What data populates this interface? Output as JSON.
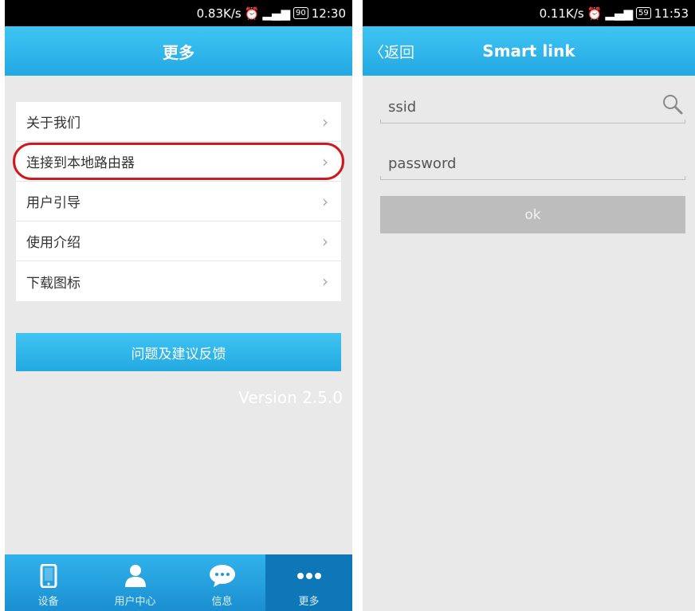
{
  "left": {
    "status": {
      "speed": "0.83K/s",
      "battery": "90",
      "time": "12:30"
    },
    "title": "更多",
    "menu": [
      {
        "label": "关于我们"
      },
      {
        "label": "连接到本地路由器",
        "highlighted": true
      },
      {
        "label": "用户引导"
      },
      {
        "label": "使用介绍"
      },
      {
        "label": "下载图标"
      }
    ],
    "feedback_button": "问题及建议反馈",
    "version": "Version 2.5.0",
    "tabs": [
      {
        "label": "设备",
        "icon": "phone-icon"
      },
      {
        "label": "用户中心",
        "icon": "user-icon"
      },
      {
        "label": "信息",
        "icon": "chat-icon"
      },
      {
        "label": "更多",
        "icon": "more-icon",
        "active": true
      }
    ]
  },
  "right": {
    "status": {
      "speed": "0.11K/s",
      "battery": "59",
      "time": "11:53"
    },
    "back_label": "返回",
    "title": "Smart link",
    "ssid_placeholder": "ssid",
    "password_placeholder": "password",
    "ok_button": "ok"
  },
  "colors": {
    "accent": "#2bb5ea",
    "highlight_ring": "#d0181e",
    "background": "#e9e9e9"
  }
}
